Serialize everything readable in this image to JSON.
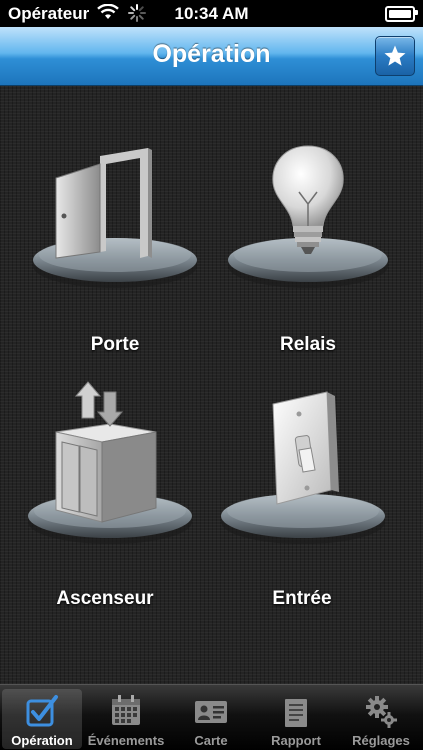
{
  "status_bar": {
    "carrier": "Opérateur",
    "time": "10:34 AM"
  },
  "nav": {
    "title": "Opération",
    "favorite_icon": "star-icon"
  },
  "tiles": [
    {
      "label": "Porte",
      "icon": "door-icon"
    },
    {
      "label": "Relais",
      "icon": "light-bulb-icon"
    },
    {
      "label": "Ascenseur",
      "icon": "elevator-icon"
    },
    {
      "label": "Entrée",
      "icon": "light-switch-icon"
    }
  ],
  "tabs": [
    {
      "label": "Opération",
      "icon": "checkbox-icon",
      "active": true
    },
    {
      "label": "Événements",
      "icon": "calendar-icon",
      "active": false
    },
    {
      "label": "Carte",
      "icon": "id-card-icon",
      "active": false
    },
    {
      "label": "Rapport",
      "icon": "report-icon",
      "active": false
    },
    {
      "label": "Réglages",
      "icon": "gears-icon",
      "active": false
    }
  ],
  "colors": {
    "nav_top": "#bfe2fb",
    "nav_bottom": "#1d74bb",
    "tab_active_icon": "#3d8fe0",
    "tab_inactive": "#9a9a9a"
  }
}
